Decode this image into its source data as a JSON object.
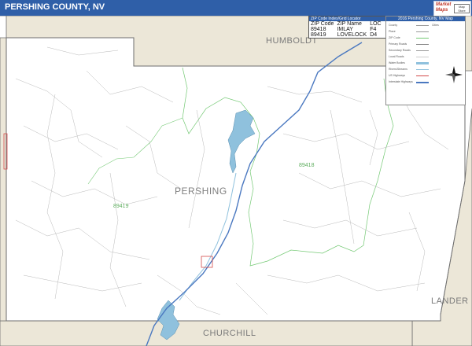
{
  "title": "PERSHING COUNTY, NV",
  "logo": {
    "line1": "Market Maps",
    "line2": "Map Store"
  },
  "counties": {
    "humboldt": "HUMBOLDT",
    "pershing": "PERSHING",
    "lander": "LANDER",
    "churchill": "CHURCHILL"
  },
  "zip_labels": {
    "z1": "89418",
    "z2": "89419"
  },
  "zip_table": {
    "header": "ZIP Code Index/Grid Locator",
    "columns": [
      "ZIP Code",
      "ZIP Name",
      "LOC"
    ],
    "rows": [
      [
        "89418",
        "IMLAY",
        "F4"
      ],
      [
        "89419",
        "LOVELOCK",
        "D4"
      ]
    ]
  },
  "legend": {
    "title": "2016 Pershing County, NV Map",
    "rows": [
      {
        "label": "County",
        "right": "Cities"
      },
      {
        "label": "Place",
        "right": ""
      },
      {
        "label": "ZIP Code",
        "right": ""
      },
      {
        "label": "Primary Roads",
        "right": ""
      },
      {
        "label": "Secondary Roads",
        "right": ""
      },
      {
        "label": "Local Roads",
        "right": ""
      },
      {
        "label": "Water Bodies",
        "right": ""
      },
      {
        "label": "Rivers/Streams",
        "right": ""
      },
      {
        "label": "US Highways",
        "right": ""
      },
      {
        "label": "Interstate Highways",
        "right": ""
      }
    ]
  },
  "colors": {
    "title_bar": "#2f5fa8",
    "county_fill": "#ece7d8",
    "county_border": "#6e6e6e",
    "zip_boundary": "#74c974",
    "water": "#8fc1dd",
    "highway": "#4a78c0",
    "roads": "#b9b9b9"
  },
  "icons": {
    "compass": "compass-rose-icon"
  }
}
